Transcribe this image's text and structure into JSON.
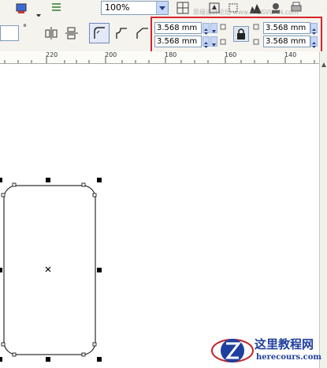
{
  "toolbar": {
    "zoom_value": "100%"
  },
  "corner_radius": {
    "top_left": "3.568 mm",
    "bottom_left": "3.568 mm",
    "top_right": "3.568 mm",
    "bottom_right": "3.568 mm"
  },
  "ruler": {
    "ticks": [
      "220",
      "200",
      "180",
      "160",
      "140"
    ]
  },
  "watermark": {
    "title": "这里教程网",
    "subtitle": "herecours.com",
    "header_watermark": "思缘设计论坛 www.MISSVUAN.com"
  },
  "colors": {
    "highlight_box": "#d9242a",
    "watermark_blue": "#1f3f9e",
    "field_border": "#7f9db9"
  }
}
